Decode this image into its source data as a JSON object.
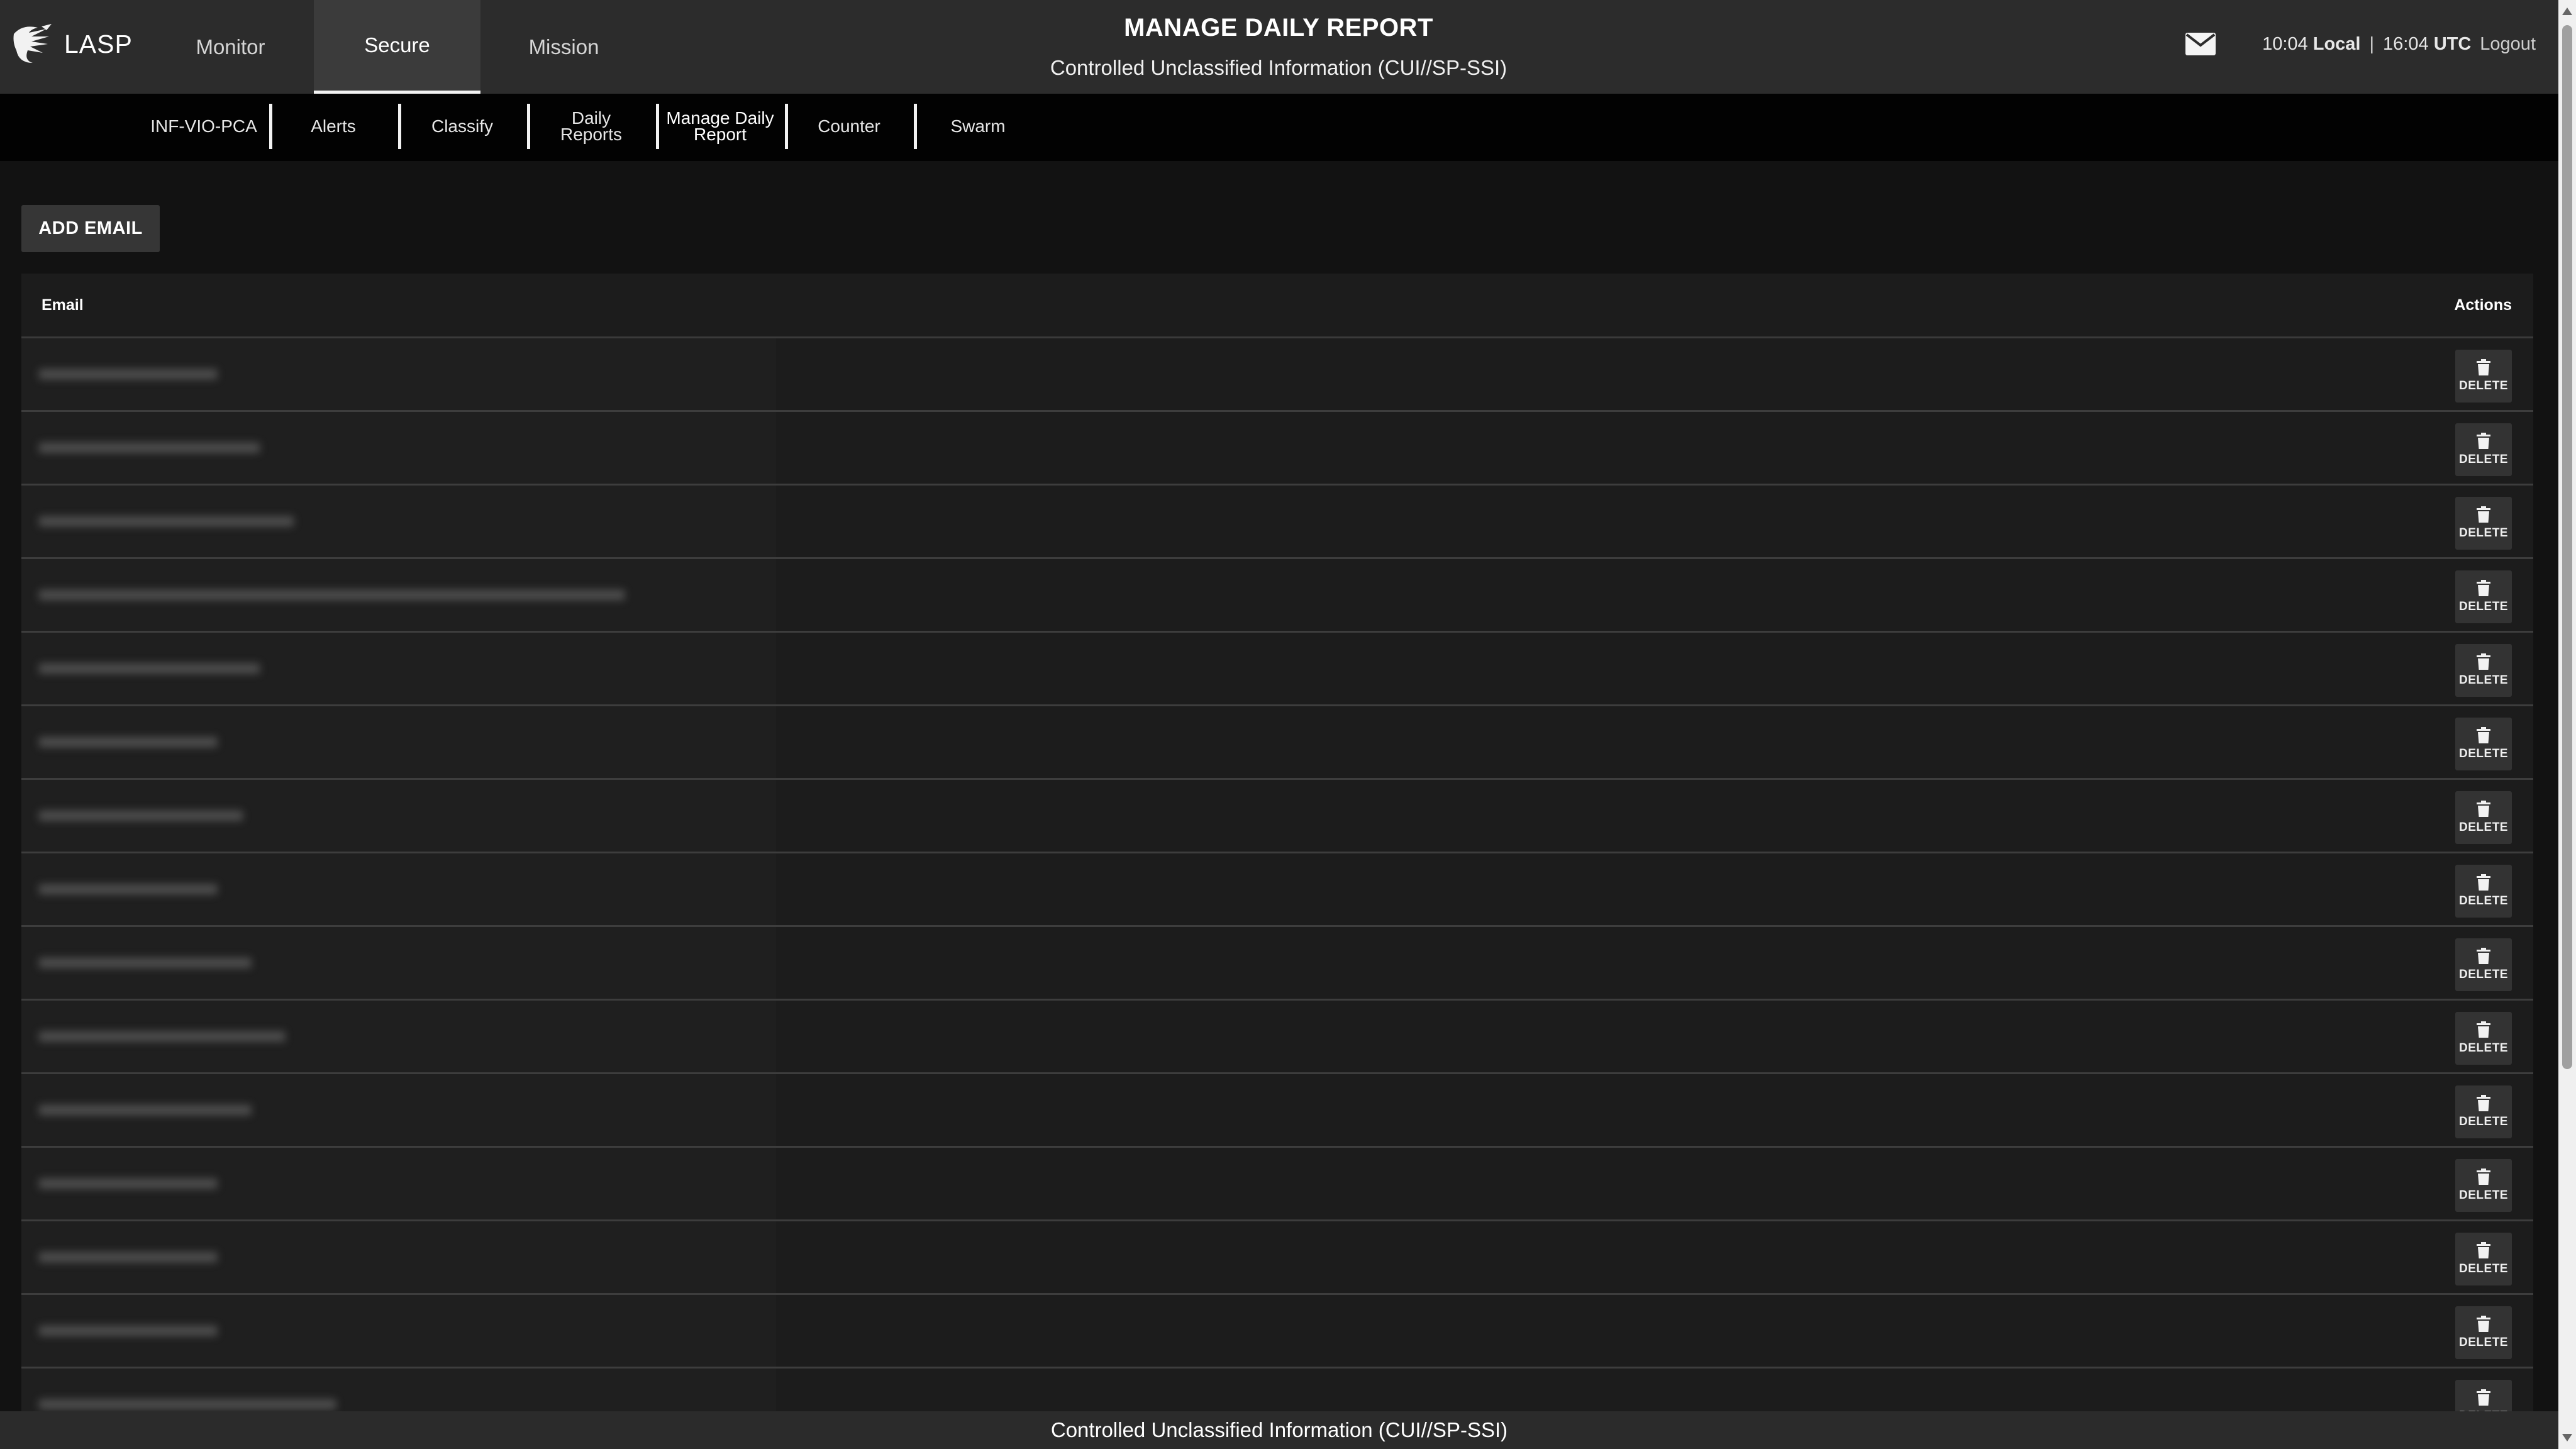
{
  "app": {
    "name": "LASP"
  },
  "top_nav": [
    {
      "label": "Monitor",
      "active": false
    },
    {
      "label": "Secure",
      "active": true
    },
    {
      "label": "Mission",
      "active": false
    }
  ],
  "header": {
    "title": "MANAGE DAILY REPORT",
    "classification": "Controlled Unclassified Information (CUI//SP-SSI)"
  },
  "time": {
    "local_time": "10:04",
    "local_label": "Local",
    "separator": "|",
    "utc_time": "16:04",
    "utc_label": "UTC",
    "logout_label": "Logout"
  },
  "sub_nav": [
    {
      "label": "INF-VIO-PCA"
    },
    {
      "label": "Alerts"
    },
    {
      "label": "Classify"
    },
    {
      "label": "Daily Reports"
    },
    {
      "label": "Manage Daily Report",
      "active": true
    },
    {
      "label": "Counter"
    },
    {
      "label": "Swarm"
    }
  ],
  "toolbar": {
    "add_email_label": "ADD EMAIL"
  },
  "table": {
    "columns": {
      "email": "Email",
      "actions": "Actions"
    },
    "delete_label": "DELETE",
    "rows": [
      {
        "email": "xxxxxxxxxxxxxxxxxxxxx"
      },
      {
        "email": "xxxxxxxxxxxxxxxxxxxxxxxxxx"
      },
      {
        "email": "xxxxxxxxxxxxxxxxxxxxxxxxxxxxxx"
      },
      {
        "email": "xxxxxxxxxxxxxxxxxxxxxxxxxxxxxxxxxxxxxxxxxxxxxxxxxxxxxxxxxxxxxxxxxxxxx"
      },
      {
        "email": "xxxxxxxxxxxxxxxxxxxxxxxxxx"
      },
      {
        "email": "xxxxxxxxxxxxxxxxxxxxx"
      },
      {
        "email": "xxxxxxxxxxxxxxxxxxxxxxxx"
      },
      {
        "email": "xxxxxxxxxxxxxxxxxxxxx"
      },
      {
        "email": "xxxxxxxxxxxxxxxxxxxxxxxxx"
      },
      {
        "email": "xxxxxxxxxxxxxxxxxxxxxxxxxxxxx"
      },
      {
        "email": "xxxxxxxxxxxxxxxxxxxxxxxxx"
      },
      {
        "email": "xxxxxxxxxxxxxxxxxxxxx"
      },
      {
        "email": "xxxxxxxxxxxxxxxxxxxxx"
      },
      {
        "email": "xxxxxxxxxxxxxxxxxxxxx"
      },
      {
        "email": "xxxxxxxxxxxxxxxxxxxxxxxxxxxxxxxxxxx"
      }
    ]
  },
  "footer": {
    "classification": "Controlled Unclassified Information (CUI//SP-SSI)"
  },
  "icons": {
    "logo": "lasp-logo-icon",
    "mail": "mail-icon",
    "delete": "trash-icon"
  },
  "colors": {
    "background": "#121212",
    "header": "#2c2c2c",
    "subnav": "#020202",
    "table": "#1c1c1c",
    "button": "#363636"
  }
}
